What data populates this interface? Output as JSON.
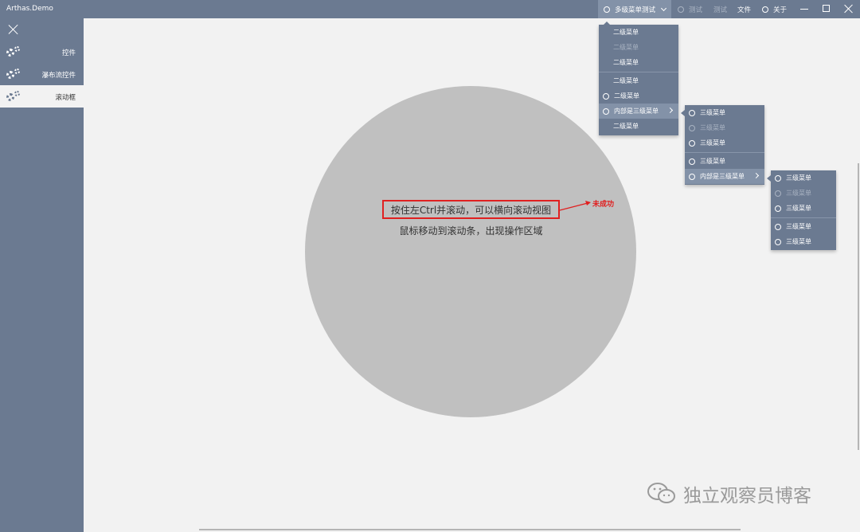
{
  "window": {
    "title": "Arthas.Demo"
  },
  "top_menu": {
    "items": [
      {
        "label": "多级菜单测试"
      },
      {
        "label": "测试"
      },
      {
        "label": "测试"
      },
      {
        "label": "文件"
      },
      {
        "label": "关于"
      }
    ]
  },
  "sidebar": {
    "items": [
      {
        "label": "控件",
        "icon": "gears-icon"
      },
      {
        "label": "瀑布流控件",
        "icon": "gears-icon"
      },
      {
        "label": "滚动框",
        "icon": "gears-icon"
      }
    ]
  },
  "menu_level2": {
    "items": [
      {
        "label": "二级菜单"
      },
      {
        "label": "二级菜单"
      },
      {
        "label": "二级菜单"
      },
      {
        "label": "二级菜单"
      },
      {
        "label": "二级菜单"
      },
      {
        "label": "内部是三级菜单"
      },
      {
        "label": "二级菜单"
      }
    ]
  },
  "menu_level3a": {
    "items": [
      {
        "label": "三级菜单"
      },
      {
        "label": "三级菜单"
      },
      {
        "label": "三级菜单"
      },
      {
        "label": "三级菜单"
      },
      {
        "label": "内部是三级菜单"
      }
    ]
  },
  "menu_level3b": {
    "items": [
      {
        "label": "三级菜单"
      },
      {
        "label": "三级菜单"
      },
      {
        "label": "三级菜单"
      },
      {
        "label": "三级菜单"
      },
      {
        "label": "三级菜单"
      }
    ]
  },
  "content": {
    "line1": "按住左Ctrl并滚动，可以横向滚动视图",
    "line2": "鼠标移动到滚动条，出现操作区域",
    "annotation": "未成功"
  },
  "watermark": {
    "text": "独立观察员博客"
  },
  "colors": {
    "chrome": "#6b7a91",
    "highlight": "#8392a8",
    "accent_red": "#e02020",
    "circle": "#c0c0c0"
  }
}
